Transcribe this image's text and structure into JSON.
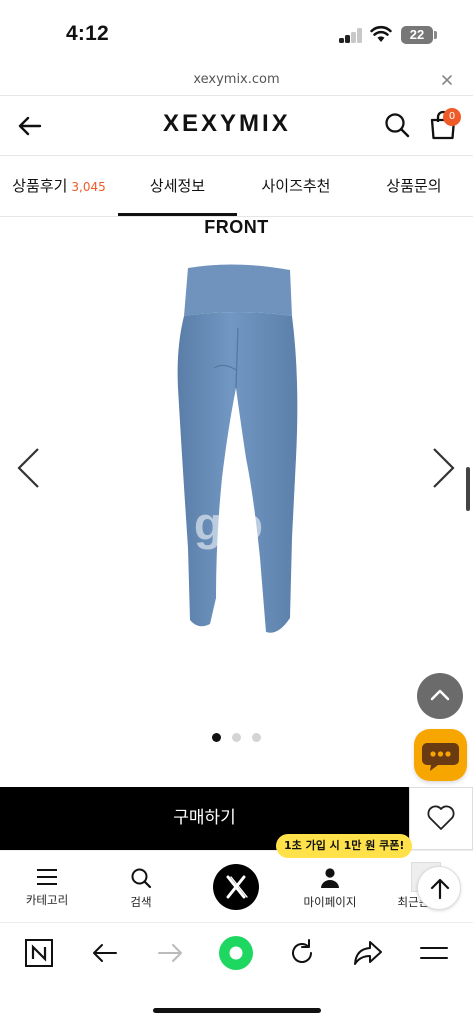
{
  "status_bar": {
    "time": "4:12",
    "battery": "22"
  },
  "url_bar": {
    "domain": "xexymix.com"
  },
  "header": {
    "brand": "XEXYMIX",
    "cart_count": "0"
  },
  "tabs": [
    {
      "label": "상품후기",
      "count": "3,045"
    },
    {
      "label": "상세정보",
      "active": true
    },
    {
      "label": "사이즈추천"
    },
    {
      "label": "상품문의"
    }
  ],
  "gallery": {
    "view_label": "FRONT",
    "image_watermark": "g.o",
    "slide_count": 3,
    "active_slide": 1,
    "product_color": "#6b8fb8"
  },
  "buy_bar": {
    "buy_label": "구매하기"
  },
  "bottom_nav": {
    "promo": "1초 가입 시 1만 원 쿠폰!",
    "items": [
      {
        "label": "카테고리",
        "icon": "menu-icon"
      },
      {
        "label": "검색",
        "icon": "search-icon"
      },
      {
        "label": "",
        "icon": "brand-x-icon"
      },
      {
        "label": "마이페이지",
        "icon": "person-icon"
      },
      {
        "label": "최근본상품",
        "icon": "recent-thumb"
      }
    ]
  },
  "colors": {
    "accent": "#f05a28",
    "chat": "#f7a600",
    "promo": "#ffe24a",
    "browser_home": "#1ed760"
  }
}
